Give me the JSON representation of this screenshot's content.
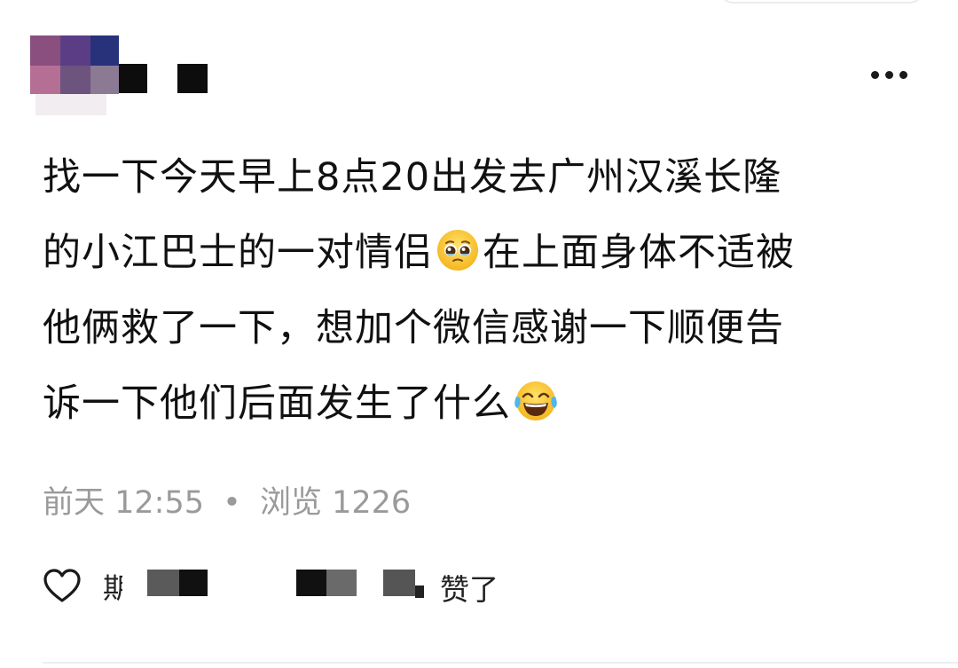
{
  "post": {
    "lines": [
      "找一下今天早上8点20出发去广州汉溪长隆",
      "的小江巴士的一对情侣",
      "在上面身体不适被",
      "他俩救了一下，想加个微信感谢一下顺便告",
      "诉一下他们后面发生了什么"
    ],
    "emoji_pleading": "🥹",
    "emoji_laughing": "😂"
  },
  "meta": {
    "time": "前天 12:55",
    "separator": "•",
    "views_label": "浏览",
    "views_count": "1226"
  },
  "likes": {
    "prefix_partial": "期",
    "suffix": "赞了"
  },
  "icons": {
    "more": "more-horizontal-icon",
    "heart": "heart-outline-icon"
  },
  "colors": {
    "text": "#111111",
    "meta": "#9a9a9a"
  }
}
